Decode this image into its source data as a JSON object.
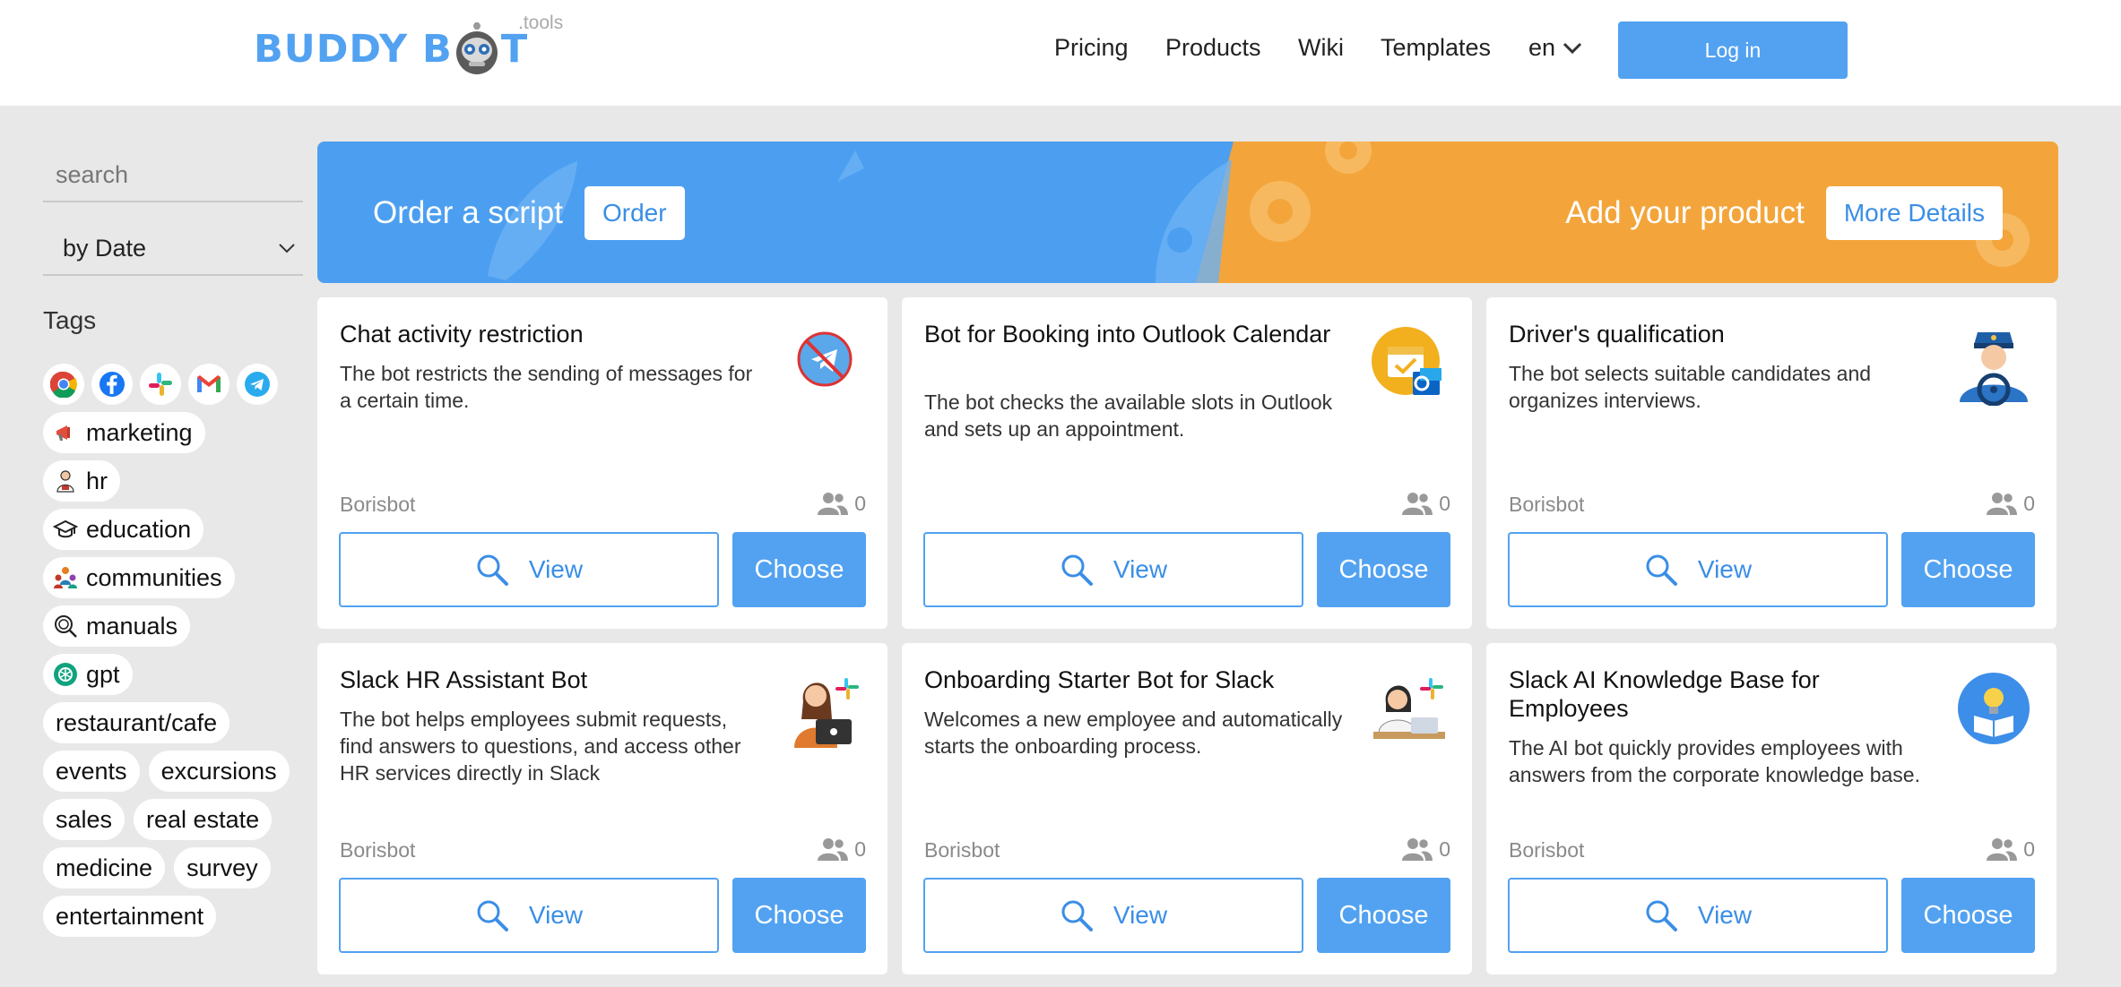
{
  "header": {
    "logo_text_left": "BUDDY B",
    "logo_text_right": "T",
    "logo_suffix": ".tools",
    "nav": [
      "Pricing",
      "Products",
      "Wiki",
      "Templates"
    ],
    "language": "en",
    "login_label": "Log in"
  },
  "sidebar": {
    "search_placeholder": "search",
    "sort_value": "by Date",
    "tags_title": "Tags",
    "social_icons": [
      "chrome-icon",
      "facebook-icon",
      "slack-icon",
      "gmail-icon",
      "telegram-icon"
    ],
    "tags": [
      {
        "label": "marketing",
        "icon": "megaphone-icon"
      },
      {
        "label": "hr",
        "icon": "hr-person-icon"
      },
      {
        "label": "education",
        "icon": "graduation-cap-icon"
      },
      {
        "label": "communities",
        "icon": "people-group-icon"
      },
      {
        "label": "manuals",
        "icon": "manual-search-icon"
      },
      {
        "label": "gpt",
        "icon": "openai-icon"
      },
      {
        "label": "restaurant/cafe"
      },
      {
        "label": "events"
      },
      {
        "label": "excursions"
      },
      {
        "label": "sales"
      },
      {
        "label": "real estate"
      },
      {
        "label": "medicine"
      },
      {
        "label": "survey"
      },
      {
        "label": "entertainment"
      }
    ]
  },
  "banner": {
    "left_text": "Order a script",
    "left_button": "Order",
    "right_text": "Add your product",
    "right_button": "More Details",
    "colors": {
      "left": "#4c9ff0",
      "right": "#f3a53b"
    }
  },
  "cards": [
    {
      "title": "Chat activity restriction",
      "description": "The bot restricts the sending of messages for a certain time.",
      "author": "Borisbot",
      "users": "0",
      "image": "no-telegram-icon"
    },
    {
      "title": "Bot for Booking into Outlook Calendar",
      "description": "The bot checks the available slots in Outlook and sets up an appointment.",
      "author": "",
      "users": "0",
      "image": "outlook-calendar-icon"
    },
    {
      "title": "Driver's qualification",
      "description": "The bot selects suitable candidates and organizes interviews.",
      "author": "Borisbot",
      "users": "0",
      "image": "driver-icon"
    },
    {
      "title": "Slack HR Assistant Bot",
      "description": "The bot helps employees submit requests, find answers to questions, and access other HR services directly in Slack",
      "author": "Borisbot",
      "users": "0",
      "image": "hr-assistant-icon"
    },
    {
      "title": "Onboarding Starter Bot for Slack",
      "description": "Welcomes a new employee and automatically starts the onboarding process.",
      "author": "Borisbot",
      "users": "0",
      "image": "onboarding-icon"
    },
    {
      "title": "Slack AI Knowledge Base for Employees",
      "description": "The AI bot quickly provides employees with answers from the corporate knowledge base.",
      "author": "Borisbot",
      "users": "0",
      "image": "lightbulb-book-icon"
    }
  ],
  "card_labels": {
    "view": "View",
    "choose": "Choose"
  },
  "colors": {
    "accent": "#52a2f1",
    "background": "#e8e8e8",
    "muted": "#8a8a8a"
  }
}
